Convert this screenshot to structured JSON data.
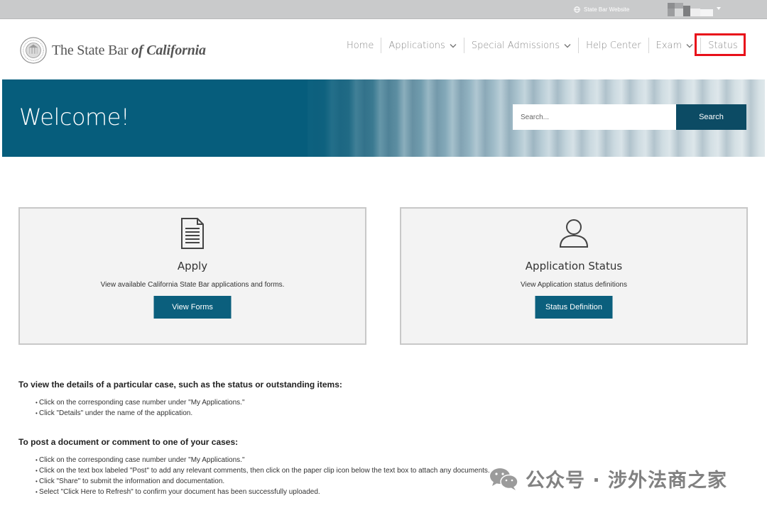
{
  "topbar": {
    "site_link": "State Bar Website",
    "site_icon": "globe-icon"
  },
  "header": {
    "logo_text_main": "The State Bar ",
    "logo_text_cal": "of California",
    "nav": [
      {
        "label": "Home",
        "dropdown": false
      },
      {
        "label": "Applications",
        "dropdown": true
      },
      {
        "label": "Special Admissions",
        "dropdown": true
      },
      {
        "label": "Help Center",
        "dropdown": false
      },
      {
        "label": "Exam",
        "dropdown": true
      },
      {
        "label": "Status",
        "dropdown": false
      }
    ],
    "highlight_color": "#e8101a"
  },
  "hero": {
    "title": "Welcome!",
    "search_placeholder": "Search...",
    "search_button": "Search"
  },
  "cards": {
    "apply": {
      "icon": "document-icon",
      "title": "Apply",
      "description": "View available California State Bar applications and forms.",
      "button": "View Forms"
    },
    "status": {
      "icon": "user-icon",
      "title": "Application Status",
      "description": "View Application status definitions",
      "button": "Status Definition"
    }
  },
  "instructions": {
    "view_details": {
      "heading": "To view the details of a particular case, such as the status or outstanding items:",
      "items": [
        "Click on the corresponding case number under \"My Applications.\"",
        "Click \"Details\" under the name of the application."
      ]
    },
    "post_document": {
      "heading": "To post a document or comment to one of your cases:",
      "items": [
        "Click on the corresponding case number under \"My Applications.\"",
        "Click on the text box labeled \"Post\" to add any relevant comments, then click on the paper clip icon below the text box to attach any documents.",
        "Click \"Share\" to submit the information and documentation.",
        "Select \"Click Here to Refresh\" to confirm your document has been successfully uploaded."
      ]
    }
  },
  "watermark": {
    "text": "公众号 · 涉外法商之家",
    "icon": "wechat-icon"
  },
  "colors": {
    "brand_teal": "#0b5f7d",
    "search_button": "#0c4b64",
    "card_bg": "#f3f3f3"
  }
}
